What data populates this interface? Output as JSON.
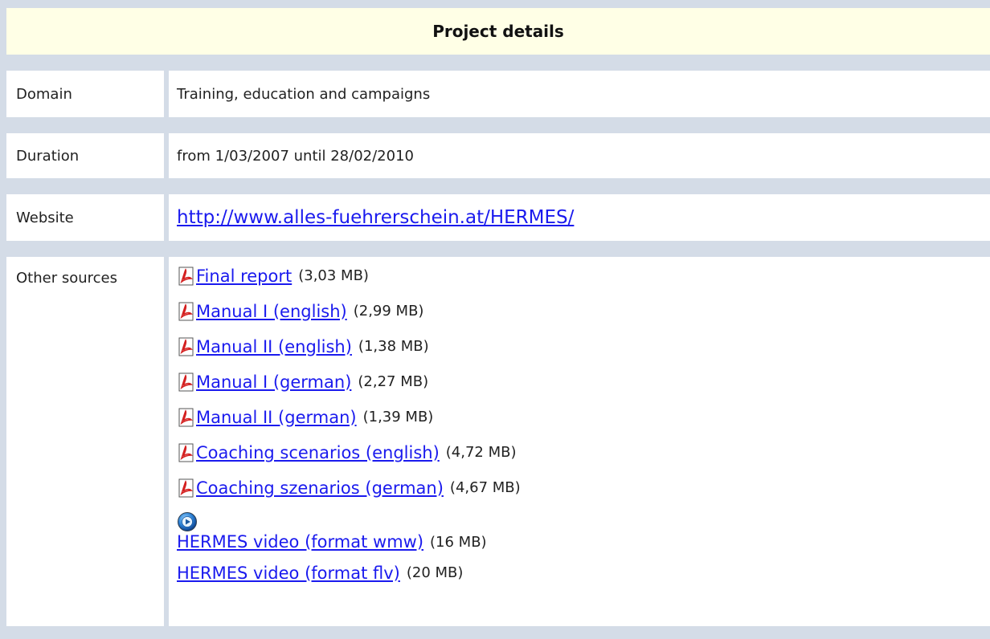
{
  "header": {
    "title": "Project details"
  },
  "rows": {
    "domain": {
      "label": "Domain",
      "value": "Training, education and campaigns"
    },
    "duration": {
      "label": "Duration",
      "value": "from 1/03/2007 until 28/02/2010"
    },
    "website": {
      "label": "Website",
      "value": "http://www.alles-fuehrerschein.at/HERMES/"
    },
    "sources": {
      "label": "Other sources",
      "items": [
        {
          "title": "Final report",
          "size": "(3,03 MB)",
          "icon": "pdf-icon"
        },
        {
          "title": "Manual I (english)",
          "size": "(2,99 MB)",
          "icon": "pdf-icon"
        },
        {
          "title": "Manual II (english)",
          "size": "(1,38 MB)",
          "icon": "pdf-icon"
        },
        {
          "title": "Manual I (german)",
          "size": "(2,27 MB)",
          "icon": "pdf-icon"
        },
        {
          "title": "Manual II (german)",
          "size": "(1,39 MB)",
          "icon": "pdf-icon"
        },
        {
          "title": "Coaching scenarios (english)",
          "size": "(4,72 MB)",
          "icon": "pdf-icon"
        },
        {
          "title": "Coaching szenarios (german)",
          "size": "(4,67 MB)",
          "icon": "pdf-icon"
        },
        {
          "title": "HERMES video (format wmw)",
          "size": "(16 MB)",
          "icon": "media-player-icon"
        },
        {
          "title": "HERMES video (format flv)",
          "size": "(20 MB)",
          "icon": ""
        }
      ]
    }
  },
  "colors": {
    "background": "#d4dce7",
    "header_bg": "#ffffe6",
    "link": "#1a1aee",
    "pdf_red": "#d42020"
  }
}
